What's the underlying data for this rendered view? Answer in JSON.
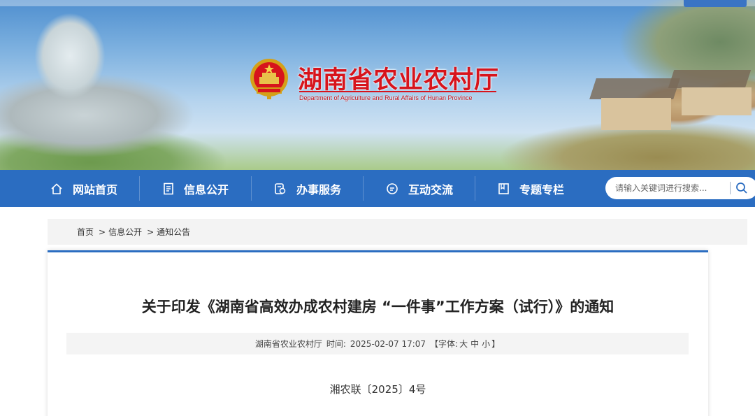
{
  "header": {
    "site_title": "湖南省农业农村厅",
    "site_subtitle": "Department of Agriculture and Rural Affairs of Hunan Province",
    "emblem_icon": "national-emblem-icon",
    "accent_color": "#d7141c"
  },
  "nav": {
    "bg_color": "#2b6dc1",
    "items": [
      {
        "label": "网站首页",
        "icon": "home-icon"
      },
      {
        "label": "信息公开",
        "icon": "document-icon"
      },
      {
        "label": "办事服务",
        "icon": "service-icon"
      },
      {
        "label": "互动交流",
        "icon": "chat-icon"
      },
      {
        "label": "专题专栏",
        "icon": "bookmark-icon"
      }
    ],
    "search": {
      "placeholder": "请输入关键词进行搜索...",
      "icon": "search-icon"
    }
  },
  "breadcrumb": {
    "items": [
      "首页",
      "信息公开",
      "通知公告"
    ],
    "separator": ">"
  },
  "article": {
    "title": "关于印发《湖南省高效办成农村建房 “一件事”工作方案（试行）》的通知",
    "source": "湖南省农业农村厅",
    "time_label": "时间:",
    "time": "2025-02-07 17:07",
    "font_label": "【字体:",
    "font_options": [
      "大",
      "中",
      "小"
    ],
    "font_close": "】",
    "doc_number": "湘农联〔2025〕4号"
  }
}
